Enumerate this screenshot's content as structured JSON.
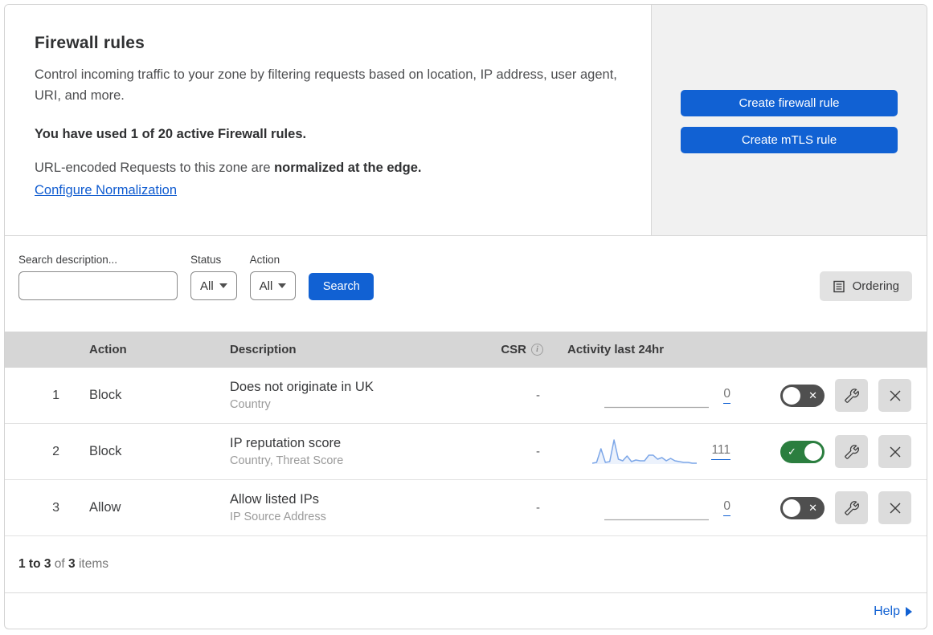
{
  "header": {
    "title": "Firewall rules",
    "description": "Control incoming traffic to your zone by filtering requests based on location, IP address, user agent, URI, and more.",
    "usage_bold": "You have used 1 of 20 active Firewall rules.",
    "normalization_prefix": "URL-encoded Requests to this zone are ",
    "normalization_bold": "normalized at the edge.",
    "link": "Configure Normalization",
    "buttons": [
      {
        "label": "Create firewall rule"
      },
      {
        "label": "Create mTLS rule"
      }
    ]
  },
  "filters": {
    "search_label": "Search description...",
    "status_label": "Status",
    "status_value": "All",
    "action_label": "Action",
    "action_value": "All",
    "search_button": "Search",
    "ordering_button": "Ordering"
  },
  "table": {
    "columns": {
      "action": "Action",
      "description": "Description",
      "csr": "CSR",
      "activity": "Activity last 24hr"
    },
    "rows": [
      {
        "priority": "1",
        "action": "Block",
        "description": "Does not originate in UK",
        "fields": "Country",
        "csr": "-",
        "activity_count": "0",
        "enabled": false,
        "sparkline": []
      },
      {
        "priority": "2",
        "action": "Block",
        "description": "IP reputation score",
        "fields": "Country, Threat Score",
        "csr": "-",
        "activity_count": "111",
        "enabled": true,
        "sparkline": [
          1,
          2,
          19,
          2,
          3,
          30,
          6,
          4,
          10,
          3,
          5,
          4,
          4,
          11,
          11,
          6,
          8,
          4,
          7,
          4,
          3,
          2,
          2,
          1,
          1
        ]
      },
      {
        "priority": "3",
        "action": "Allow",
        "description": "Allow listed IPs",
        "fields": "IP Source Address",
        "csr": "-",
        "activity_count": "0",
        "enabled": false,
        "sparkline": []
      }
    ]
  },
  "footer": {
    "range_bold": "1 to 3",
    "of_text": " of ",
    "total_bold": "3",
    "items_text": " items",
    "help_label": "Help"
  },
  "colors": {
    "accent_blue": "#1161d3",
    "link_blue": "#0f5bd0",
    "toggle_on": "#2b7e3f",
    "toggle_off": "#4f4f4f",
    "sparkline_stroke": "#7da7e8",
    "sparkline_fill": "rgba(125,167,232,0.15)",
    "flat_line": "#a9a9a9",
    "table_header_bg": "#d6d6d6"
  }
}
